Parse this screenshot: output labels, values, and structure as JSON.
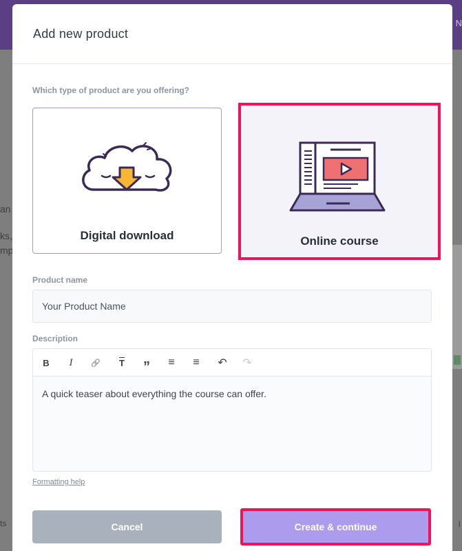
{
  "background": {
    "topbar_fragment": "N",
    "left_fragments": [
      "an",
      "ks,",
      "mp"
    ],
    "bottom_left_fragment": "ts",
    "bottom_right_fragment": "I"
  },
  "modal": {
    "title": "Add new product",
    "type_question": "Which type of product are you offering?",
    "product_types": [
      {
        "label": "Digital download",
        "icon": "cloud-download-icon",
        "selected": false
      },
      {
        "label": "Online course",
        "icon": "laptop-video-icon",
        "selected": true
      }
    ],
    "product_name": {
      "label": "Product name",
      "placeholder": "Your Product Name",
      "value": ""
    },
    "description": {
      "label": "Description",
      "toolbar": [
        {
          "glyph": "B",
          "icon": "bold-icon"
        },
        {
          "glyph": "I",
          "icon": "italic-icon"
        },
        {
          "glyph": "🔗",
          "icon": "link-icon"
        },
        {
          "glyph": "T",
          "icon": "heading-icon"
        },
        {
          "glyph": "”",
          "icon": "quote-icon"
        },
        {
          "glyph": "≡",
          "icon": "bullet-list-icon"
        },
        {
          "glyph": "≡",
          "icon": "numbered-list-icon"
        },
        {
          "glyph": "↶",
          "icon": "undo-icon"
        },
        {
          "glyph": "↷",
          "icon": "redo-icon"
        }
      ],
      "placeholder": "A quick teaser about everything the course can offer."
    },
    "formatting_help": "Formatting help",
    "buttons": {
      "cancel": "Cancel",
      "create": "Create & continue"
    },
    "colors": {
      "highlight": "#f2125c",
      "create_button": "#ad9bed",
      "cancel_button": "#a9b2bc",
      "card_border": "#9f9bc7"
    }
  }
}
